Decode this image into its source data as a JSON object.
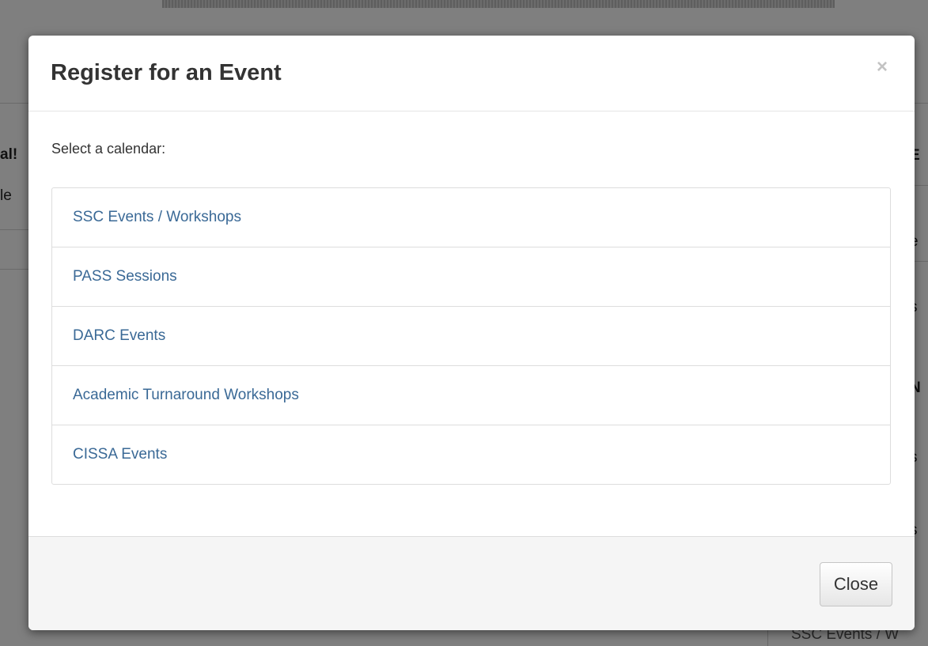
{
  "background": {
    "left_heading": "al!",
    "left_text": "le",
    "right_texts": [
      "E",
      "e",
      ":",
      "s",
      "N",
      ":",
      "s",
      ":",
      "s",
      ":"
    ],
    "bottom_label": "SSC Events / W"
  },
  "modal": {
    "title": "Register for an Event",
    "close_icon": "×",
    "prompt": "Select a calendar:",
    "calendars": [
      {
        "label": "SSC Events / Workshops"
      },
      {
        "label": "PASS Sessions"
      },
      {
        "label": "DARC Events"
      },
      {
        "label": "Academic Turnaround Workshops"
      },
      {
        "label": "CISSA Events"
      }
    ],
    "close_button_label": "Close"
  },
  "colors": {
    "link": "#3a6996",
    "title": "#333333",
    "backdrop": "rgba(0,0,0,0.5)"
  }
}
